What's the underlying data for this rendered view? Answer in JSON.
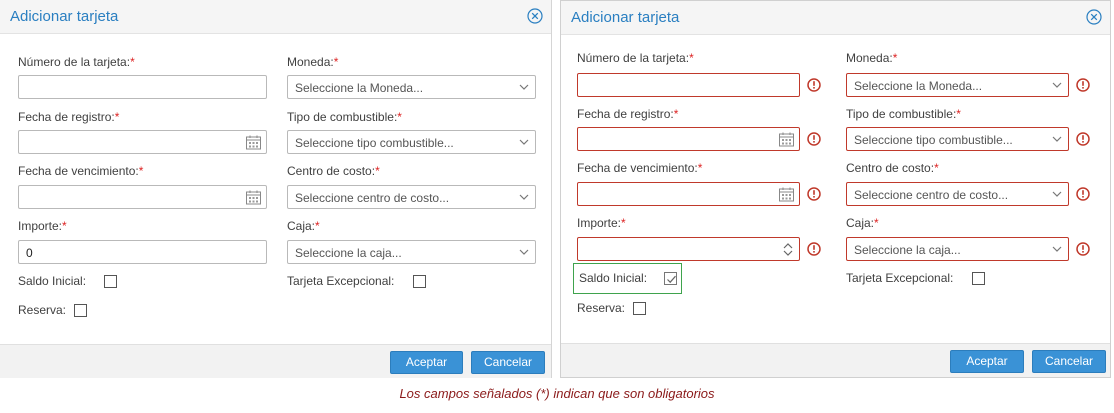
{
  "colors": {
    "accent": "#2a7fc1",
    "required": "#d22222",
    "error": "#c0392b",
    "focus": "#3fa34d",
    "button": "#3a92d6"
  },
  "dialog": {
    "title": "Adicionar tarjeta",
    "close_icon": "close-circle-icon",
    "fields": {
      "card_number": {
        "label": "Número de la tarjeta:",
        "required_mark": "*"
      },
      "currency": {
        "label": "Moneda:",
        "required_mark": "*",
        "placeholder": "Seleccione la Moneda..."
      },
      "reg_date": {
        "label": "Fecha de registro:",
        "required_mark": "*"
      },
      "fuel_type": {
        "label": "Tipo de combustible:",
        "required_mark": "*",
        "placeholder": "Seleccione tipo combustible..."
      },
      "exp_date": {
        "label": "Fecha de vencimiento:",
        "required_mark": "*"
      },
      "cost_center": {
        "label": "Centro de costo:",
        "required_mark": "*",
        "placeholder": "Seleccione centro de costo..."
      },
      "amount": {
        "label": "Importe:",
        "required_mark": "*"
      },
      "cashbox": {
        "label": "Caja:",
        "required_mark": "*",
        "placeholder": "Seleccione la caja..."
      },
      "initial_balance": {
        "label": "Saldo Inicial:"
      },
      "exceptional_card": {
        "label": "Tarjeta Excepcional:"
      },
      "reserve": {
        "label": "Reserva:"
      }
    },
    "accept_label": "Aceptar",
    "cancel_label": "Cancelar"
  },
  "left_state": {
    "amount_value": "0",
    "initial_balance_checked": false,
    "exceptional_checked": false,
    "reserve_checked": false
  },
  "right_state": {
    "amount_value": "",
    "initial_balance_checked": true,
    "exceptional_checked": false,
    "reserve_checked": false,
    "error_icon": "exclamation-circle-icon"
  },
  "footnote": "Los campos señalados (*) indican que son obligatorios"
}
